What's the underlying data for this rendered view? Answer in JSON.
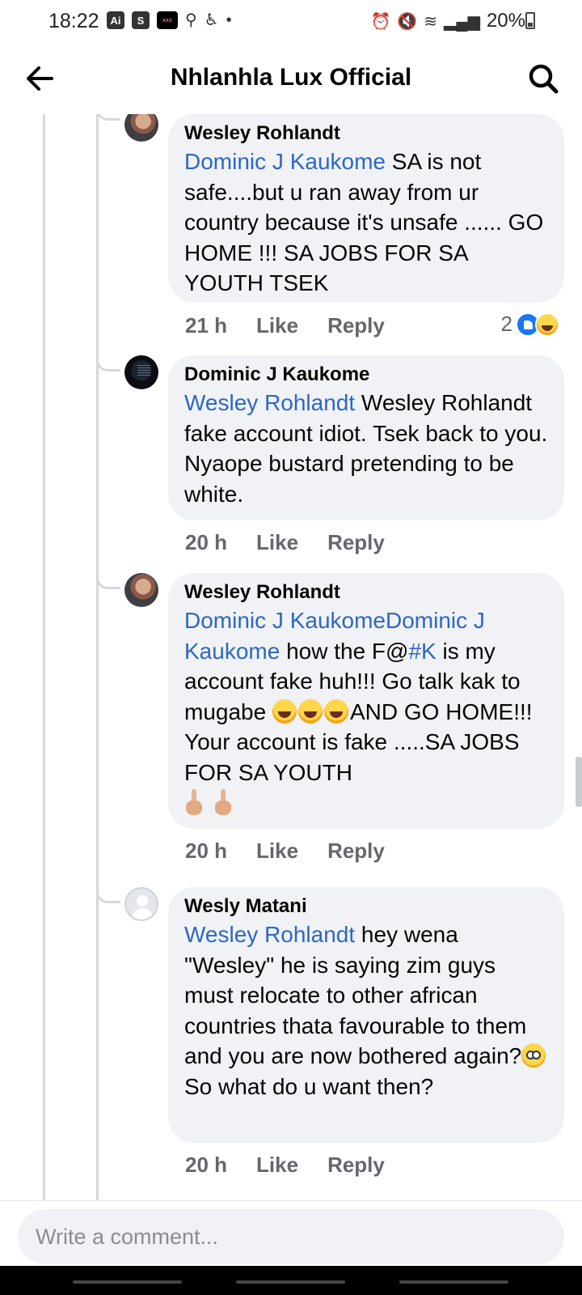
{
  "status_bar": {
    "time": "18:22",
    "app_badges": [
      "Ai",
      "S"
    ],
    "dark_badge": "xxx",
    "battery": "20%",
    "icons": [
      "location-icon",
      "accessibility-icon",
      "alarm-icon",
      "mute-icon",
      "wifi-icon",
      "signal-icon",
      "battery-icon"
    ]
  },
  "header": {
    "title": "Nhlanhla Lux Official",
    "back_icon": "back-arrow-icon",
    "search_icon": "search-icon"
  },
  "comments": [
    {
      "author": "Wesley Rohlandt",
      "mention": "Dominic J Kaukome",
      "body": " SA is not safe....but u ran away from ur country because it's unsafe ...... GO HOME !!! SA JOBS FOR SA YOUTH TSEK",
      "time": "21 h",
      "like": "Like",
      "reply": "Reply",
      "reaction_count": "2"
    },
    {
      "author": "Dominic J Kaukome",
      "mention": "Wesley Rohlandt",
      "body": " Wesley Rohlandt fake account idiot. Tsek back to you. Nyaope bustard pretending to be white.",
      "time": "20 h",
      "like": "Like",
      "reply": "Reply"
    },
    {
      "author": "Wesley Rohlandt",
      "mention": "Dominic J KaukomeDominic J Kaukome",
      "body_a": " how the F@",
      "mention_b": "#K",
      "body_b": " is my account fake huh!!! Go talk kak to mugabe ",
      "body_c": "AND GO HOME!!! Your account is fake .....SA JOBS FOR SA YOUTH",
      "time": "20 h",
      "like": "Like",
      "reply": "Reply"
    },
    {
      "author": "Wesly Matani",
      "mention": "Wesley Rohlandt",
      "body_a": " hey wena \"Wesley\" he is saying zim guys must relocate to other african countries thata favourable to them and you are now bothered again?",
      "body_b": " So what do u want then?",
      "time": "20 h",
      "like": "Like",
      "reply": "Reply"
    }
  ],
  "composer": {
    "placeholder": "Write a comment..."
  },
  "colors": {
    "mention": "#2d67c4",
    "bubble": "#f0f2f5",
    "meta": "#65676b",
    "like_reaction": "#1877f2"
  }
}
